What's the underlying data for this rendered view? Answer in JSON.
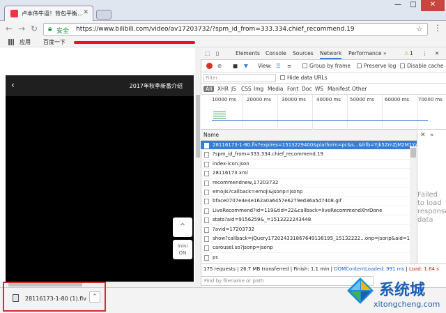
{
  "browser": {
    "tab_title": "卢本伟牛逼！背包平衡…",
    "tab_close": "✕",
    "window_min": "—",
    "window_max": "□",
    "window_close": "✕",
    "secure_label": "安全",
    "url": "https://www.bilibili.com/video/av17203732/?spm_id_from=333.334.chief_recommend.19",
    "bookmarks": {
      "apps": "应用",
      "baidu": "百度一下"
    }
  },
  "page": {
    "video_header_title": "2017年秋季新番介绍",
    "mini_label": "mini",
    "on_label": "ON"
  },
  "devtools": {
    "tabs": [
      "Elements",
      "Console",
      "Sources",
      "Network",
      "Performance"
    ],
    "warning_count": "1",
    "view_label": "View:",
    "group_by_frame": "Group by frame",
    "preserve_log": "Preserve log",
    "disable_cache": "Disable cache",
    "filter_placeholder": "Filter",
    "hide_data_urls": "Hide data URLs",
    "types": [
      "All",
      "XHR",
      "JS",
      "CSS",
      "Img",
      "Media",
      "Font",
      "Doc",
      "WS",
      "Manifest",
      "Other"
    ],
    "timeline_ticks": [
      "10000 ms",
      "20000 ms",
      "30000 ms",
      "40000 ms",
      "50000 ms",
      "60000 ms",
      "70000 ms"
    ],
    "name_header": "Name",
    "rows": [
      "28116173-1-80.flv?expires=1513229400&platform=pc&s...&hfb=Yjk5ZmZjM2M1YzY",
      "?spm_id_from=333.334.chief_recommend.19",
      "index-icon.json",
      "28116173.xml",
      "recommendnew,17203732",
      "emojis?callback=emoji&jsonp=jsonp",
      "bface0707e4e4e162a0a6457e6279ed36a5d7408.gif",
      "LiveRecommend?id=119&tid=22&callback=liveRecommendXhrDone",
      "stats?aid=9156259&_=1513222243448",
      "?avid=17203732",
      "show?callback=jQuery1720243318676491381​95_15132222...onp=jsonp&aid=172037",
      "carousel.so?jsonp=jsonp",
      "pc"
    ],
    "side_panel_text": "Failed to load response data",
    "status": {
      "requests": "175 requests",
      "transferred": "26.7 MB transferred",
      "finish": "Finish: 1.1 min",
      "dcl": "DOMContentLoaded: 991 ms",
      "load": "Load: 1.64 s"
    },
    "find_placeholder": "Find by filename or path"
  },
  "downloads": {
    "file_name": "28116173-1-80 (1).flv"
  },
  "watermark": {
    "brand": "系统城",
    "url": "xitongcheng.com"
  },
  "colors": {
    "selected_row": "#3a7bd5",
    "record": "#d93025",
    "highlight_box": "#d32d2d",
    "underline_red": "#e0142b"
  }
}
